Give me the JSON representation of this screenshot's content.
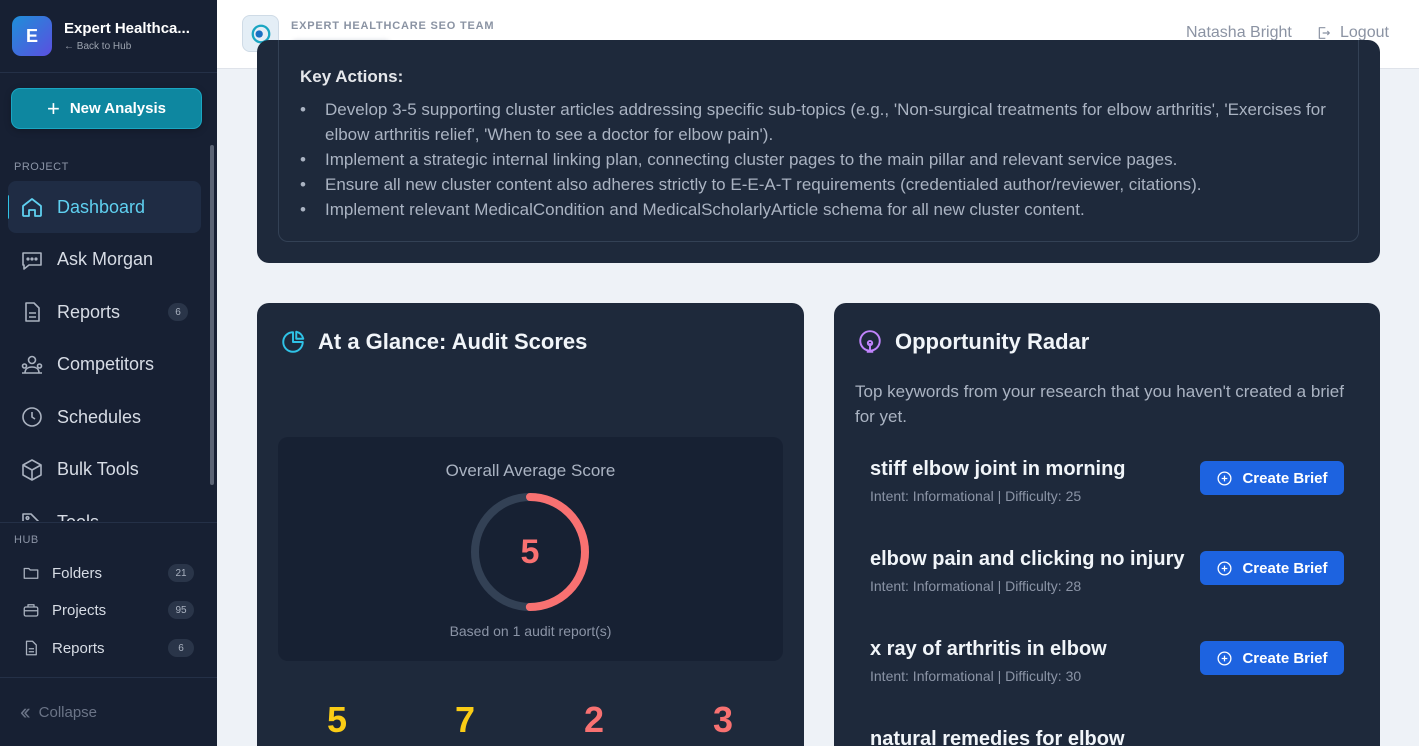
{
  "brand": {
    "initial": "E",
    "name": "Expert Healthca...",
    "back": "← Back to Hub",
    "new_analysis": "New Analysis"
  },
  "sidebar": {
    "project_label": "PROJECT",
    "items": [
      {
        "label": "Dashboard",
        "icon": "home-icon",
        "active": true
      },
      {
        "label": "Ask Morgan",
        "icon": "chat-icon"
      },
      {
        "label": "Reports",
        "icon": "document-icon",
        "badge": "6"
      },
      {
        "label": "Competitors",
        "icon": "users-icon"
      },
      {
        "label": "Schedules",
        "icon": "clock-icon"
      },
      {
        "label": "Bulk Tools",
        "icon": "box-icon"
      },
      {
        "label": "Tools",
        "icon": "tag-icon"
      }
    ],
    "hub_label": "HUB",
    "hub_items": [
      {
        "label": "Folders",
        "badge": "21",
        "icon": "folder-icon"
      },
      {
        "label": "Projects",
        "badge": "95",
        "icon": "briefcase-icon"
      },
      {
        "label": "Reports",
        "badge": "6",
        "icon": "document-icon"
      }
    ],
    "collapse": "Collapse"
  },
  "topbar": {
    "team": "EXPERT HEALTHCARE SEO TEAM",
    "user": "Natasha Bright",
    "logout": "Logout"
  },
  "key_actions": {
    "title": "Key Actions:",
    "items": [
      "Develop 3-5 supporting cluster articles addressing specific sub-topics (e.g., 'Non-surgical treatments for elbow arthritis', 'Exercises for elbow arthritis relief', 'When to see a doctor for elbow pain').",
      "Implement a strategic internal linking plan, connecting cluster pages to the main pillar and relevant service pages.",
      "Ensure all new cluster content also adheres strictly to E-E-A-T requirements (credentialed author/reviewer, citations).",
      "Implement relevant MedicalCondition and MedicalScholarlyArticle schema for all new cluster content."
    ]
  },
  "audit": {
    "title": "At a Glance: Audit Scores",
    "score_label": "Overall Average Score",
    "score": "5",
    "score_fraction": 0.5,
    "note": "Based on 1 audit report(s)",
    "mini_scores": [
      {
        "value": "5",
        "color": "#facc15"
      },
      {
        "value": "7",
        "color": "#facc15"
      },
      {
        "value": "2",
        "color": "#f87171"
      },
      {
        "value": "3",
        "color": "#f87171"
      }
    ]
  },
  "radar": {
    "title": "Opportunity Radar",
    "description": "Top keywords from your research that you haven't created a brief for yet.",
    "button_label": "Create Brief",
    "opportunities": [
      {
        "keyword": "stiff elbow joint in morning",
        "meta": "Intent: Informational | Difficulty: 25"
      },
      {
        "keyword": "elbow pain and clicking no injury",
        "meta": "Intent: Informational | Difficulty: 28"
      },
      {
        "keyword": "x ray of arthritis in elbow",
        "meta": "Intent: Informational | Difficulty: 30"
      },
      {
        "keyword": "natural remedies for elbow",
        "meta": ""
      }
    ]
  },
  "colors": {
    "accent": "#0e87a0",
    "sidebar_bg": "#172033",
    "card_bg": "#1e293b",
    "button_blue": "#1d63e0",
    "danger": "#f87171",
    "warning": "#facc15"
  }
}
